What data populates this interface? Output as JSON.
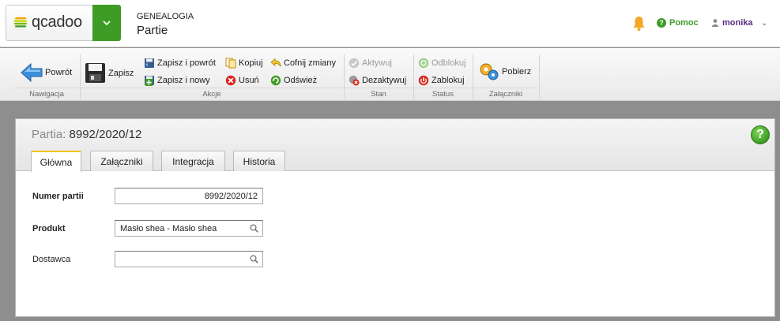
{
  "brand": {
    "name": "qcadoo",
    "menu_toggle_icon": "chevron-down-icon"
  },
  "header": {
    "module": "GENEALOGIA",
    "view_title": "Partie",
    "help_label": "Pomoc",
    "user_name": "monika",
    "notification_icon": "bell-icon",
    "accent": "#3e9b26"
  },
  "ribbon": {
    "groups": {
      "navigation": "Nawigacja",
      "actions": "Akcje",
      "state": "Stan",
      "status": "Status",
      "attachments": "Załączniki"
    },
    "buttons": {
      "back": "Powrót",
      "save": "Zapisz",
      "save_back": "Zapisz i powrót",
      "save_new": "Zapisz i nowy",
      "copy": "Kopiuj",
      "delete": "Usuń",
      "undo": "Cofnij zmiany",
      "refresh": "Odśwież",
      "activate": "Aktywuj",
      "deactivate": "Dezaktywuj",
      "unblock": "Odblokuj",
      "block": "Zablokuj",
      "download": "Pobierz"
    }
  },
  "form": {
    "title_label": "Partia:",
    "title_value": "8992/2020/12",
    "tabs": [
      "Główna",
      "Załączniki",
      "Integracja",
      "Historia"
    ],
    "active_tab": "Główna",
    "fields": {
      "batch_number": {
        "label": "Numer partii",
        "value": "8992/2020/12"
      },
      "product": {
        "label": "Produkt",
        "value": "Masło shea - Masło shea"
      },
      "supplier": {
        "label": "Dostawca",
        "value": ""
      }
    }
  }
}
